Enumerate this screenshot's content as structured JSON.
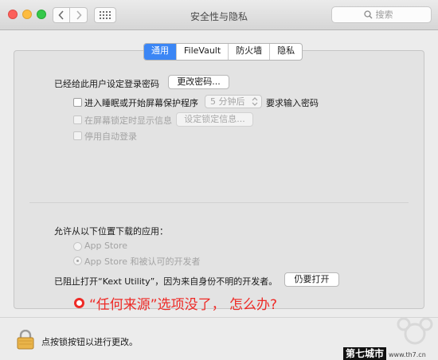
{
  "window": {
    "title": "安全性与隐私",
    "search_placeholder": "搜索"
  },
  "tabs": [
    {
      "label": "通用",
      "active": true
    },
    {
      "label": "FileVault",
      "active": false
    },
    {
      "label": "防火墙",
      "active": false
    },
    {
      "label": "隐私",
      "active": false
    }
  ],
  "general": {
    "login_password_label": "已经给此用户设定登录密码",
    "change_password_button": "更改密码...",
    "require_password_checkbox": {
      "label": "进入睡眠或开始屏幕保护程序",
      "checked": false
    },
    "require_password_delay": "5 分钟后",
    "require_password_suffix": "要求输入密码",
    "lock_message_checkbox": {
      "label": "在屏幕锁定时显示信息",
      "checked": false
    },
    "set_lock_message_button": "设定锁定信息...",
    "disable_autologin_checkbox": {
      "label": "停用自动登录",
      "checked": false
    }
  },
  "downloads": {
    "heading": "允许从以下位置下载的应用：",
    "options": [
      {
        "label": "App Store",
        "selected": false
      },
      {
        "label": "App Store 和被认可的开发者",
        "selected": true
      }
    ],
    "blocked_message": "已阻止打开“Kext Utility”，因为来自身份不明的开发者。",
    "open_anyway_button": "仍要打开"
  },
  "annotation": {
    "text": "“任何来源”选项没了， 怎么办?",
    "color": "#ee2a26"
  },
  "footer": {
    "lock_text": "点按锁按钮以进行更改。"
  },
  "watermark": {
    "brand": "第七城市",
    "url": "www.th7.cn"
  },
  "colors": {
    "accent": "#3b86f5",
    "close": "#fc605b",
    "minimize": "#fdbc40",
    "zoom": "#34c84a"
  },
  "icons": [
    "chevron-left-icon",
    "chevron-right-icon",
    "grid-icon",
    "search-icon",
    "lock-icon"
  ]
}
